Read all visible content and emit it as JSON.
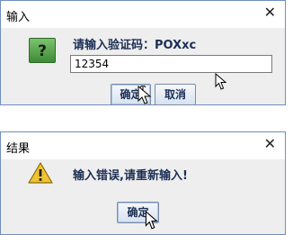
{
  "input_dialog": {
    "title": "输入",
    "close_symbol": "✕",
    "question_icon_glyph": "?",
    "prompt": "请输入验证码：POXxc",
    "field_value": "12354",
    "ok_label": "确定",
    "cancel_label": "取消"
  },
  "result_dialog": {
    "title": "结果",
    "close_symbol": "✕",
    "message": "输入错误,请重新输入!",
    "ok_label": "确定"
  },
  "icons": {
    "question": "question-icon",
    "warning": "warning-icon",
    "cursor": "mouse-pointer-icon"
  },
  "colors": {
    "border": "#6f8fbf",
    "dialog_bg": "#eeeeee",
    "question_green": "#3e8b35",
    "warning_yellow": "#f1c232",
    "label_text": "#1c2f55"
  }
}
